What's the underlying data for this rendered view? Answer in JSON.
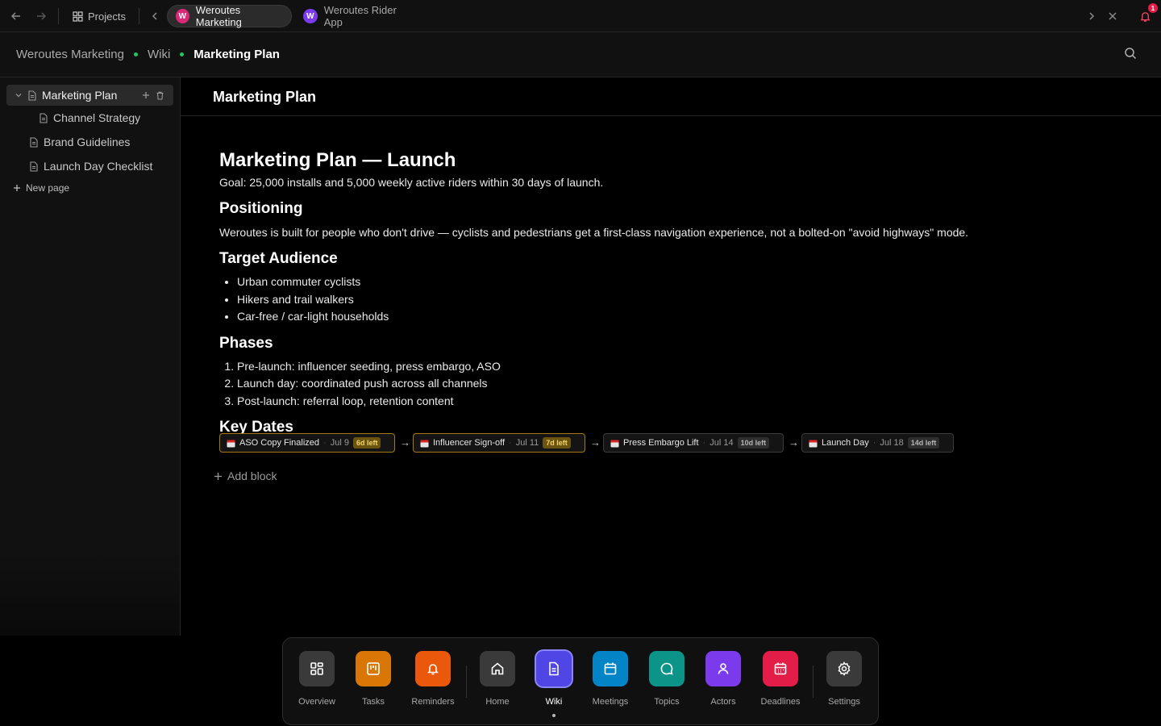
{
  "topbar": {
    "projects_label": "Projects",
    "tabs": [
      {
        "label": "Weroutes Marketing",
        "avatar": "W",
        "avatar_color": "#db2777",
        "active": true
      },
      {
        "label": "Weroutes Rider App",
        "avatar": "W",
        "avatar_color": "#7c3aed",
        "active": false
      }
    ],
    "notification_count": "1"
  },
  "breadcrumb": [
    "Weroutes Marketing",
    "Wiki",
    "Marketing Plan"
  ],
  "sidebar": {
    "pages": [
      {
        "label": "Marketing Plan",
        "selected": true,
        "expanded": true
      },
      {
        "label": "Channel Strategy",
        "child": true
      },
      {
        "label": "Brand Guidelines"
      },
      {
        "label": "Launch Day Checklist"
      }
    ],
    "new_page_label": "New page"
  },
  "main": {
    "title": "Marketing Plan",
    "doc": {
      "h1": "Marketing Plan — Launch",
      "goal": "Goal: 25,000 installs and 5,000 weekly active riders within 30 days of launch.",
      "positioning_heading": "Positioning",
      "positioning_text": "Weroutes is built for people who don't drive — cyclists and pedestrians get a first-class navigation experience, not a bolted-on \"avoid highways\" mode.",
      "audience_heading": "Target Audience",
      "audience": [
        "Urban commuter cyclists",
        "Hikers and trail walkers",
        "Car-free / car-light households"
      ],
      "phases_heading": "Phases",
      "phases": [
        "Pre-launch: influencer seeding, press embargo, ASO",
        "Launch day: coordinated push across all channels",
        "Post-launch: referral loop, retention content"
      ],
      "key_dates_heading": "Key Dates",
      "key_dates": [
        {
          "name": "ASO Copy Finalized",
          "date": "Jul 9",
          "left": "6d left",
          "status": "warn"
        },
        {
          "name": "Influencer Sign-off",
          "date": "Jul 11",
          "left": "7d left",
          "status": "warn"
        },
        {
          "name": "Press Embargo Lift",
          "date": "Jul 14",
          "left": "10d left",
          "status": "normal"
        },
        {
          "name": "Launch Day",
          "date": "Jul 18",
          "left": "14d left",
          "status": "normal"
        }
      ]
    },
    "add_block_label": "Add block"
  },
  "dock": {
    "items": [
      {
        "label": "Overview",
        "color": "#3a3a3a",
        "icon": "grid-icon"
      },
      {
        "label": "Tasks",
        "color": "#d97706",
        "icon": "kanban-icon"
      },
      {
        "label": "Reminders",
        "color": "#ea580c",
        "icon": "bell-icon"
      },
      {
        "label": "Home",
        "color": "#3a3a3a",
        "icon": "home-icon"
      },
      {
        "label": "Wiki",
        "color": "#4f46e5",
        "icon": "document-icon",
        "active": true
      },
      {
        "label": "Meetings",
        "color": "#0284c7",
        "icon": "calendar-icon"
      },
      {
        "label": "Topics",
        "color": "#0d9488",
        "icon": "chat-icon"
      },
      {
        "label": "Actors",
        "color": "#7c3aed",
        "icon": "user-icon"
      },
      {
        "label": "Deadlines",
        "color": "#e11d48",
        "icon": "calendar-grid-icon"
      },
      {
        "label": "Settings",
        "color": "#3a3a3a",
        "icon": "gear-icon"
      }
    ]
  }
}
